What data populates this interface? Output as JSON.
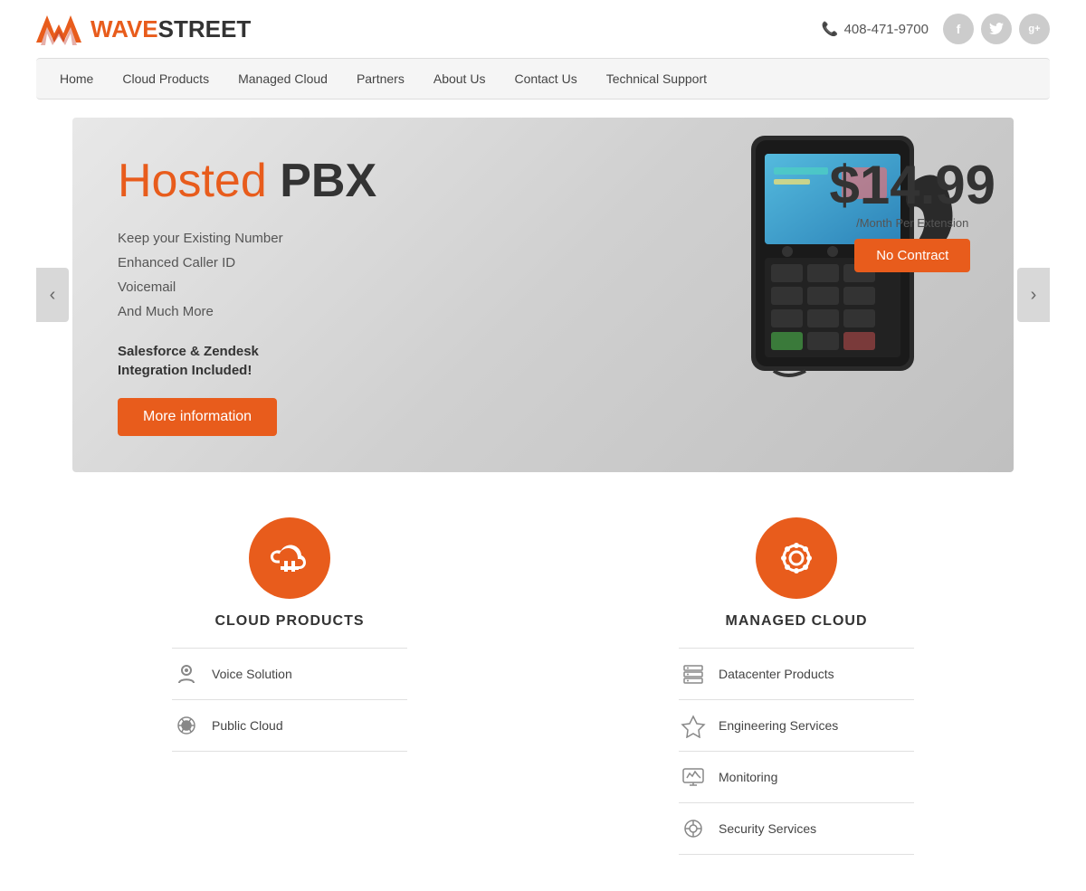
{
  "brand": {
    "name_wave": "WAVE",
    "name_street": "STREET",
    "phone": "408-471-9700"
  },
  "social": [
    {
      "name": "facebook",
      "label": "f"
    },
    {
      "name": "twitter",
      "label": "t"
    },
    {
      "name": "google-plus",
      "label": "g+"
    }
  ],
  "nav": {
    "items": [
      {
        "label": "Home",
        "id": "home"
      },
      {
        "label": "Cloud Products",
        "id": "cloud-products"
      },
      {
        "label": "Managed Cloud",
        "id": "managed-cloud"
      },
      {
        "label": "Partners",
        "id": "partners"
      },
      {
        "label": "About Us",
        "id": "about-us"
      },
      {
        "label": "Contact Us",
        "id": "contact-us"
      },
      {
        "label": "Technical Support",
        "id": "technical-support"
      }
    ]
  },
  "hero": {
    "title_colored": "Hosted ",
    "title_bold": "PBX",
    "price": "$14.99",
    "price_sub": "/Month Per Extension",
    "no_contract": "No Contract",
    "features": [
      "Keep your Existing Number",
      "Enhanced Caller ID",
      "Voicemail",
      "And Much More"
    ],
    "salesforce_text": "Salesforce & Zendesk\nIntegration Included!",
    "btn_more": "More information",
    "arrow_left": "‹",
    "arrow_right": "›"
  },
  "services": {
    "cloud_products": {
      "title": "CLOUD PRODUCTS",
      "items": [
        {
          "label": "Voice Solution",
          "icon": "mic"
        },
        {
          "label": "Public Cloud",
          "icon": "cloud"
        }
      ]
    },
    "managed_cloud": {
      "title": "MANAGED CLOUD",
      "items": [
        {
          "label": "Datacenter Products",
          "icon": "server"
        },
        {
          "label": "Engineering Services",
          "icon": "tools"
        },
        {
          "label": "Monitoring",
          "icon": "monitor"
        },
        {
          "label": "Security Services",
          "icon": "gear"
        }
      ]
    }
  }
}
